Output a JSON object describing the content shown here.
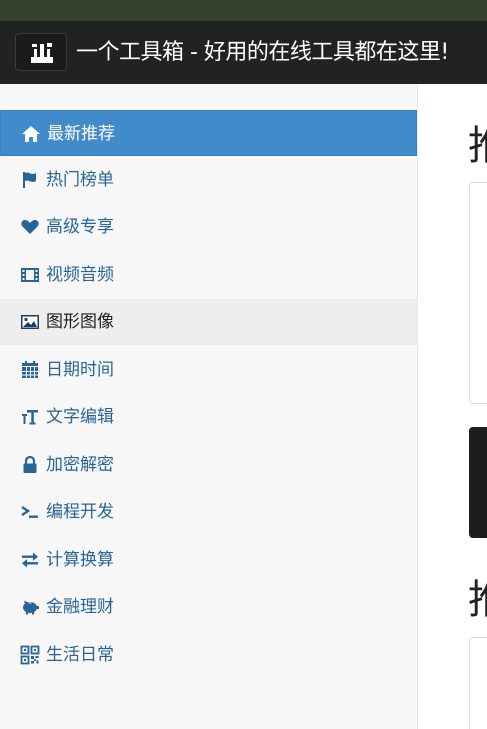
{
  "header": {
    "title": "一个工具箱 - 好用的在线工具都在这里!",
    "logo_icon": "toolbox-icon"
  },
  "sidebar": {
    "items": [
      {
        "label": "最新推荐",
        "icon": "home-icon",
        "state": "active"
      },
      {
        "label": "热门榜单",
        "icon": "flag-icon",
        "state": "normal"
      },
      {
        "label": "高级专享",
        "icon": "heart-icon",
        "state": "normal"
      },
      {
        "label": "视频音频",
        "icon": "film-icon",
        "state": "normal"
      },
      {
        "label": "图形图像",
        "icon": "picture-icon",
        "state": "hover"
      },
      {
        "label": "日期时间",
        "icon": "calendar-icon",
        "state": "normal"
      },
      {
        "label": "文字编辑",
        "icon": "text-height-icon",
        "state": "normal"
      },
      {
        "label": "加密解密",
        "icon": "lock-icon",
        "state": "normal"
      },
      {
        "label": "编程开发",
        "icon": "terminal-icon",
        "state": "normal"
      },
      {
        "label": "计算换算",
        "icon": "exchange-icon",
        "state": "normal"
      },
      {
        "label": "金融理财",
        "icon": "piggy-bank-icon",
        "state": "normal"
      },
      {
        "label": "生活日常",
        "icon": "qrcode-icon",
        "state": "normal"
      }
    ]
  },
  "main": {
    "section_1_heading": "推",
    "section_2_heading": "推"
  },
  "colors": {
    "top_strip": "#35422f",
    "navbar": "#222222",
    "active_item": "#428bca",
    "link": "#2a6496",
    "sidebar_bg": "#f7f7f7"
  }
}
